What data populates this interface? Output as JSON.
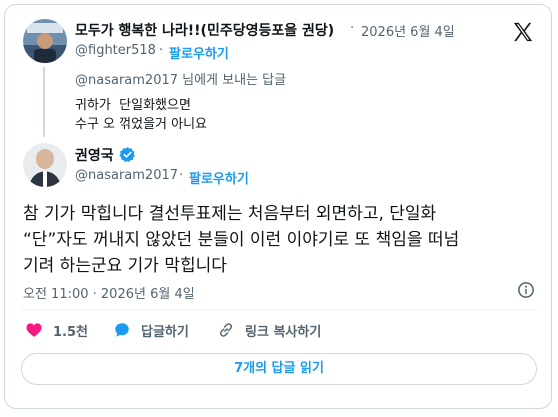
{
  "reply_tweet": {
    "display_name": "모두가 행복한 나라!!(민주당영등포을 권당)",
    "handle": "@fighter518",
    "date": "2026년 6월 4일",
    "follow_label": "팔로우하기",
    "replying_to": "@nasaram2017 님에게 보내는 답글",
    "text_line1": "귀하가  단일화했으면",
    "text_line2": "수구 오 꺾었을거 아니요"
  },
  "main_tweet": {
    "display_name": "권영국",
    "handle": "@nasaram2017",
    "follow_label": "팔로우하기",
    "text": "참 기가 막힙니다 결선투표제는 처음부터 외면하고, 단일화\n“단”자도 꺼내지 않았던 분들이 이런 이야기로 또 책임을 떠넘\n기려 하는군요 기가 막힙니다",
    "timestamp": "오전 11:00 · 2026년 6월 4일"
  },
  "actions": {
    "like_count": "1.5천",
    "reply_label": "답글하기",
    "copy_link_label": "링크 복사하기"
  },
  "read_replies_label": "7개의 답글 읽기",
  "separator_dot": "·",
  "colors": {
    "accent": "#1d9bf0",
    "like": "#f91880",
    "verified": "#1d9bf0"
  }
}
